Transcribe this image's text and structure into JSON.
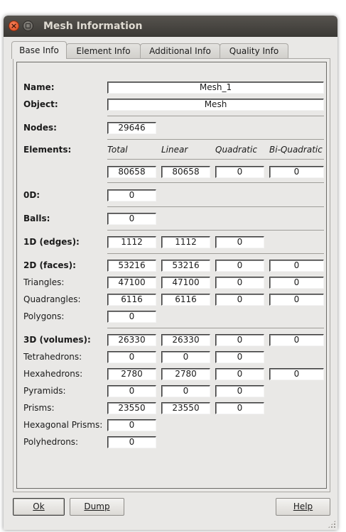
{
  "window": {
    "title": "Mesh Information"
  },
  "tabs": [
    "Base Info",
    "Element Info",
    "Additional Info",
    "Quality Info"
  ],
  "name": {
    "label": "Name:",
    "value": "Mesh_1"
  },
  "object": {
    "label": "Object:",
    "value": "Mesh"
  },
  "nodes": {
    "label": "Nodes:",
    "value": "29646"
  },
  "elements": {
    "label": "Elements:",
    "headers": [
      "Total",
      "Linear",
      "Quadratic",
      "Bi-Quadratic"
    ],
    "values": [
      "80658",
      "80658",
      "0",
      "0"
    ]
  },
  "zero_d": {
    "label": "0D:",
    "value": "0"
  },
  "balls": {
    "label": "Balls:",
    "value": "0"
  },
  "edges_1d": {
    "label": "1D (edges):",
    "values": [
      "1112",
      "1112",
      "0"
    ]
  },
  "faces_2d": {
    "label": "2D (faces):",
    "values": [
      "53216",
      "53216",
      "0",
      "0"
    ],
    "triangles": {
      "label": "Triangles:",
      "values": [
        "47100",
        "47100",
        "0",
        "0"
      ]
    },
    "quadrangles": {
      "label": "Quadrangles:",
      "values": [
        "6116",
        "6116",
        "0",
        "0"
      ]
    },
    "polygons": {
      "label": "Polygons:",
      "value": "0"
    }
  },
  "volumes_3d": {
    "label": "3D (volumes):",
    "values": [
      "26330",
      "26330",
      "0",
      "0"
    ],
    "tetrahedrons": {
      "label": "Tetrahedrons:",
      "values": [
        "0",
        "0",
        "0"
      ]
    },
    "hexahedrons": {
      "label": "Hexahedrons:",
      "values": [
        "2780",
        "2780",
        "0",
        "0"
      ]
    },
    "pyramids": {
      "label": "Pyramids:",
      "values": [
        "0",
        "0",
        "0"
      ]
    },
    "prisms": {
      "label": "Prisms:",
      "values": [
        "23550",
        "23550",
        "0"
      ]
    },
    "hex_prisms": {
      "label": "Hexagonal Prisms:",
      "value": "0"
    },
    "polyhedrons": {
      "label": "Polyhedrons:",
      "value": "0"
    }
  },
  "buttons": {
    "ok": "Ok",
    "dump": "Dump",
    "help": "Help"
  }
}
